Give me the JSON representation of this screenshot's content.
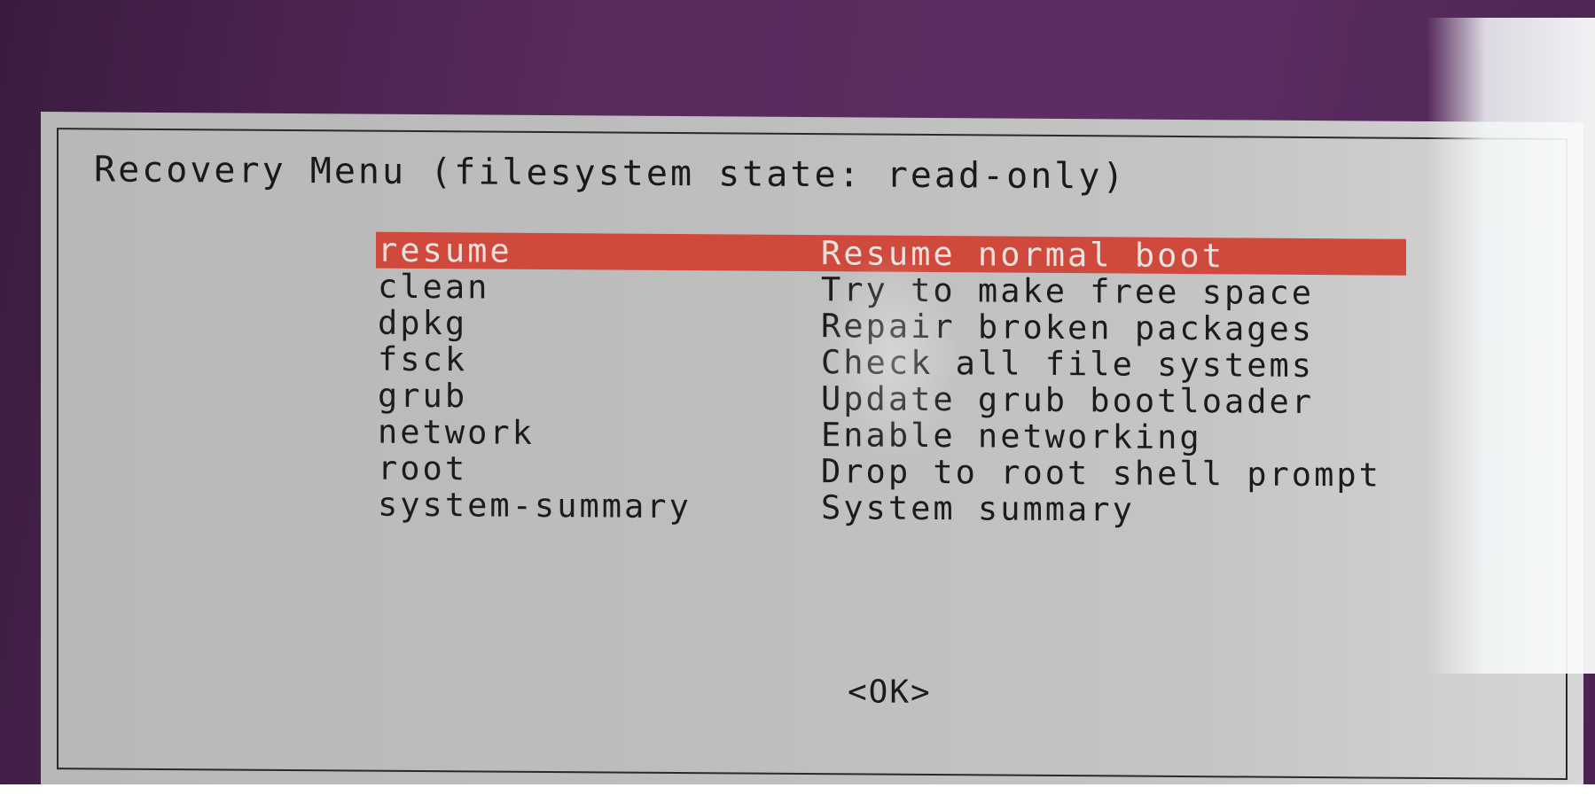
{
  "dialog": {
    "title": "Recovery Menu (filesystem state: read-only)",
    "ok_label": "<OK>"
  },
  "menu": {
    "items": [
      {
        "key": "resume",
        "desc": "Resume normal boot",
        "selected": true
      },
      {
        "key": "clean",
        "desc": "Try to make free space",
        "selected": false
      },
      {
        "key": "dpkg",
        "desc": "Repair broken packages",
        "selected": false
      },
      {
        "key": "fsck",
        "desc": "Check all file systems",
        "selected": false
      },
      {
        "key": "grub",
        "desc": "Update grub bootloader",
        "selected": false
      },
      {
        "key": "network",
        "desc": "Enable networking",
        "selected": false
      },
      {
        "key": "root",
        "desc": "Drop to root shell prompt",
        "selected": false
      },
      {
        "key": "system-summary",
        "desc": "System summary",
        "selected": false
      }
    ]
  },
  "colors": {
    "background": "#5a2a5e",
    "dialog": "#bdbdbd",
    "highlight": "#cf4a3c",
    "text": "#1c1c1c"
  }
}
